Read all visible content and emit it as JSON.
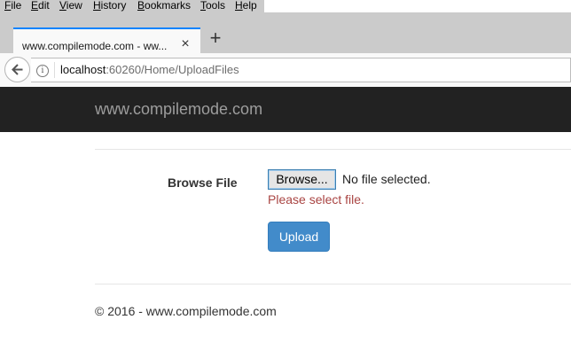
{
  "browser": {
    "menu": [
      "File",
      "Edit",
      "View",
      "History",
      "Bookmarks",
      "Tools",
      "Help"
    ],
    "tab": {
      "title": "www.compilemode.com - ww..."
    },
    "url": {
      "host": "localhost",
      "rest": ":60260/Home/UploadFiles"
    }
  },
  "site": {
    "brand": "www.compilemode.com",
    "form": {
      "label": "Browse File",
      "browse_button": "Browse...",
      "file_status": "No file selected.",
      "error": "Please select file.",
      "upload_button": "Upload"
    },
    "footer": "© 2016 - www.compilemode.com"
  },
  "colors": {
    "header_bg": "#222222",
    "brand_text": "#9d9d9d",
    "error_text": "#a94442",
    "primary_button": "#428bca",
    "tab_accent": "#0a84ff"
  },
  "icons": [
    "back-arrow-icon",
    "info-icon",
    "close-icon",
    "plus-icon"
  ]
}
